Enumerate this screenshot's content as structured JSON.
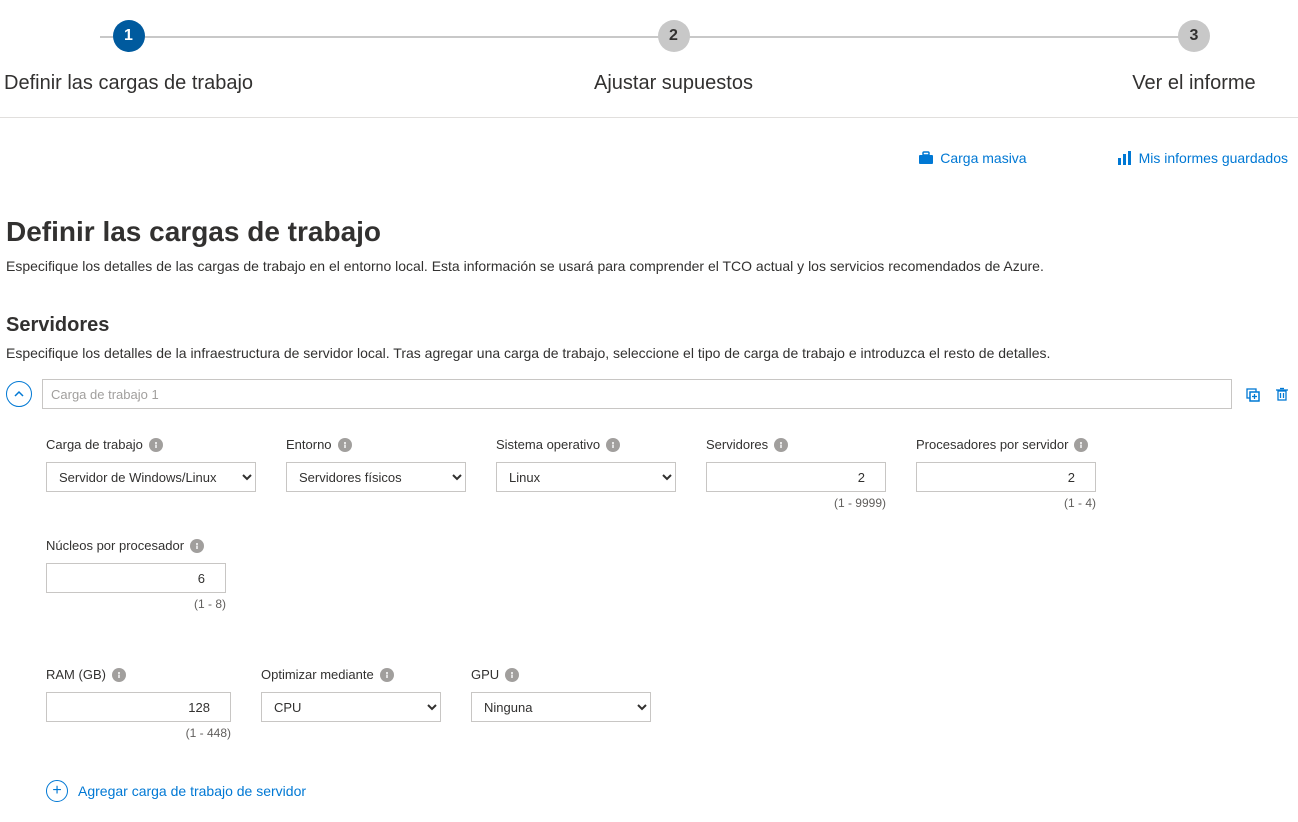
{
  "stepper": {
    "steps": [
      {
        "num": "1",
        "label": "Definir las cargas de trabajo",
        "active": true
      },
      {
        "num": "2",
        "label": "Ajustar supuestos",
        "active": false
      },
      {
        "num": "3",
        "label": "Ver el informe",
        "active": false
      }
    ]
  },
  "actions": {
    "bulk_upload": "Carga masiva",
    "saved_reports": "Mis informes guardados"
  },
  "page": {
    "title": "Definir las cargas de trabajo",
    "subtitle": "Especifique los detalles de las cargas de trabajo en el entorno local. Esta información se usará para comprender el TCO actual y los servicios recomendados de Azure."
  },
  "servers": {
    "heading": "Servidores",
    "desc": "Especifique los detalles de la infraestructura de servidor local. Tras agregar una carga de trabajo, seleccione el tipo de carga de trabajo e introduzca el resto de detalles.",
    "workload_name_placeholder": "Carga de trabajo 1",
    "add_label": "Agregar carga de trabajo de servidor",
    "fields": {
      "workload": {
        "label": "Carga de trabajo",
        "value": "Servidor de Windows/Linux"
      },
      "environment": {
        "label": "Entorno",
        "value": "Servidores físicos"
      },
      "os": {
        "label": "Sistema operativo",
        "value": "Linux"
      },
      "servers_count": {
        "label": "Servidores",
        "value": "2",
        "hint": "(1 - 9999)"
      },
      "procs": {
        "label": "Procesadores por servidor",
        "value": "2",
        "hint": "(1 - 4)"
      },
      "cores": {
        "label": "Núcleos por procesador",
        "value": "6",
        "hint": "(1 - 8)"
      },
      "ram": {
        "label": "RAM (GB)",
        "value": "128",
        "hint": "(1 - 448)"
      },
      "optimize": {
        "label": "Optimizar mediante",
        "value": "CPU"
      },
      "gpu": {
        "label": "GPU",
        "value": "Ninguna"
      }
    }
  }
}
